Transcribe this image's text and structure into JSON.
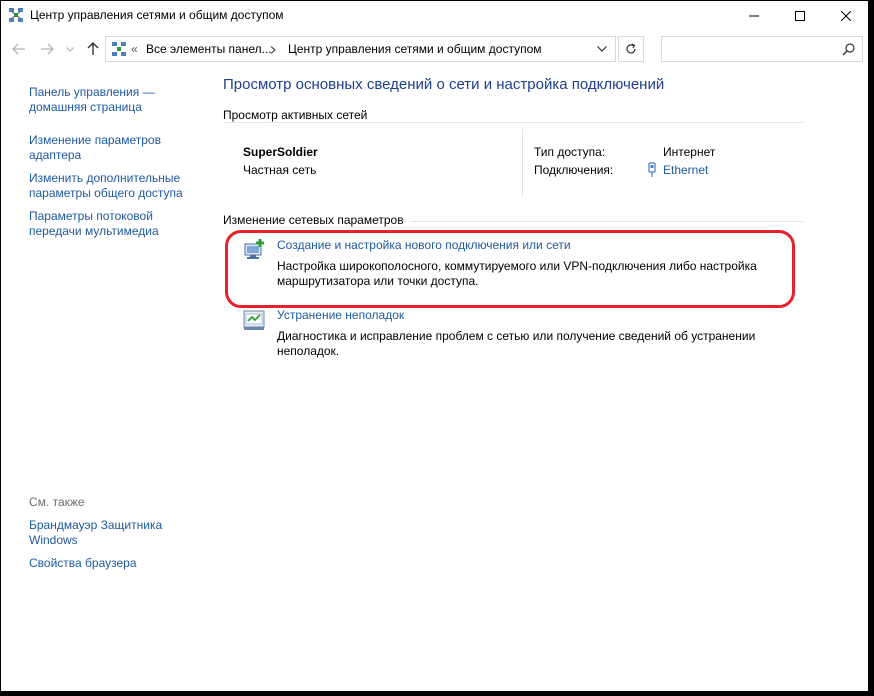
{
  "window": {
    "title": "Центр управления сетями и общим доступом"
  },
  "address": {
    "separator": "«",
    "part1": "Все элементы панел...",
    "part2": "Центр управления сетями и общим доступом"
  },
  "search": {
    "placeholder": ""
  },
  "left": {
    "links": [
      "Панель управления — домашняя страница",
      "Изменение параметров адаптера",
      "Изменить дополнительные параметры общего доступа",
      "Параметры потоковой передачи мультимедиа"
    ],
    "see_also_title": "См. также",
    "see_also": [
      "Брандмауэр Защитника Windows",
      "Свойства браузера"
    ]
  },
  "main": {
    "title": "Просмотр основных сведений о сети и настройка подключений",
    "active_header": "Просмотр активных сетей",
    "network": {
      "name": "SuperSoldier",
      "type": "Частная сеть",
      "access_label": "Тип доступа:",
      "access_value": "Интернет",
      "connections_label": "Подключения:",
      "connection_link": "Ethernet"
    },
    "change_header": "Изменение сетевых параметров",
    "tasks": [
      {
        "link": "Создание и настройка нового подключения или сети",
        "desc": "Настройка широкополосного, коммутируемого или VPN-подключения либо настройка маршрутизатора или точки доступа."
      },
      {
        "link": "Устранение неполадок",
        "desc": "Диагностика и исправление проблем с сетью или получение сведений об устранении неполадок."
      }
    ]
  },
  "colors": {
    "link": "#1e5aa0",
    "title": "#1e3f8f",
    "highlight": "#e8202a"
  }
}
